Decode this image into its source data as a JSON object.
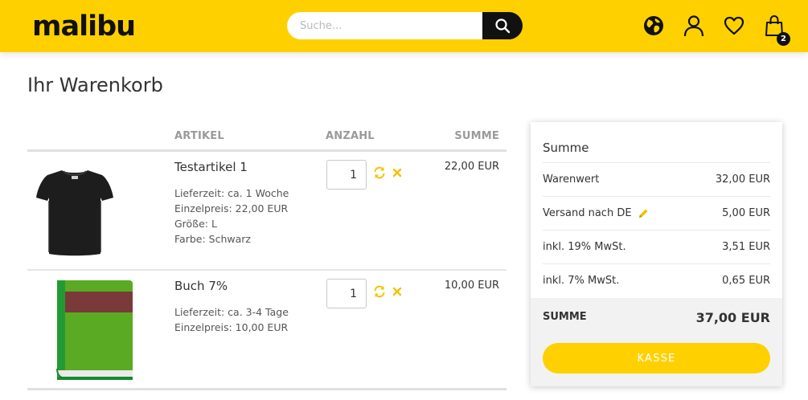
{
  "header": {
    "logo": "malibu",
    "search_placeholder": "Suche...",
    "icons": [
      "search-icon",
      "globe-icon",
      "user-icon",
      "heart-icon",
      "shopping-bag-icon"
    ],
    "cart_count": "2",
    "brand_color": "#ffd000"
  },
  "page": {
    "title": "Ihr Warenkorb"
  },
  "table": {
    "headers": {
      "article": "ARTIKEL",
      "quantity": "ANZAHL",
      "sum": "SUMME"
    },
    "items": [
      {
        "name": "Testartikel 1",
        "meta": [
          "Lieferzeit: ca. 1 Woche",
          "Einzelpreis: 22,00 EUR",
          "Größe: L",
          "Farbe: Schwarz"
        ],
        "quantity": "1",
        "total": "22,00 EUR",
        "image": "black-tshirt-image"
      },
      {
        "name": "Buch 7%",
        "meta": [
          "Lieferzeit: ca. 3-4 Tage",
          "Einzelpreis: 10,00 EUR"
        ],
        "quantity": "1",
        "total": "10,00 EUR",
        "image": "green-book-image"
      }
    ],
    "action_icons": [
      "refresh-icon",
      "remove-icon"
    ]
  },
  "summary": {
    "title": "Summe",
    "rows": [
      {
        "label": "Warenwert",
        "value": "32,00 EUR"
      },
      {
        "label": "Versand nach DE",
        "value": "5,00 EUR",
        "icon": "pencil-icon"
      },
      {
        "label": "inkl. 19% MwSt.",
        "value": "3,51 EUR"
      },
      {
        "label": "inkl. 7% MwSt.",
        "value": "0,65 EUR"
      }
    ],
    "total_label": "SUMME",
    "total_value": "37,00 EUR",
    "checkout_label": "KASSE"
  }
}
